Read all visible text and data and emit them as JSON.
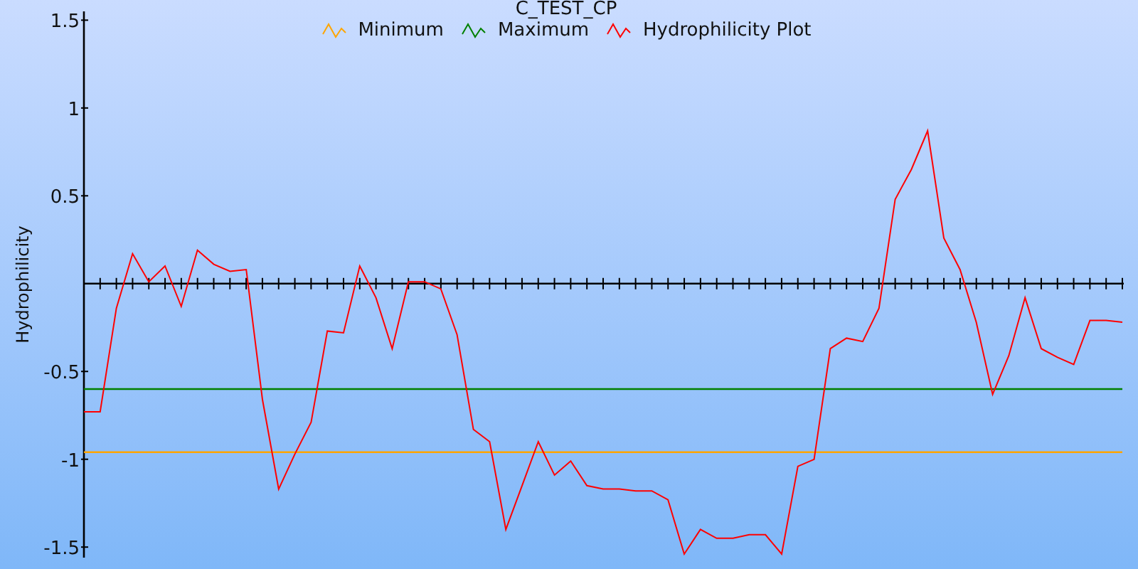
{
  "chart": {
    "chart_data": {
      "type": "line",
      "title": "C_TEST_CP",
      "ylabel": "Hydrophilicity",
      "categories": [
        null,
        null,
        null,
        null,
        null,
        null,
        null,
        null,
        null,
        null,
        null,
        null,
        null,
        null,
        null,
        null,
        null,
        null,
        null,
        null,
        null,
        null,
        null,
        null,
        null,
        null,
        null,
        null,
        null,
        null,
        null,
        null,
        null,
        null,
        null,
        null,
        null,
        null,
        null,
        null,
        null,
        null,
        null,
        null,
        null,
        null,
        null,
        null,
        null,
        null,
        null,
        null,
        null,
        null,
        null,
        null,
        null,
        null,
        null,
        null,
        null,
        null,
        null,
        null,
        null
      ],
      "ylim": [
        -1.56,
        1.55
      ],
      "yticks": [
        {
          "value": -1.5,
          "label": "-1.5"
        },
        {
          "value": -1,
          "label": "-1"
        },
        {
          "value": -0.5,
          "label": "-0.5"
        },
        {
          "value": 0.5,
          "label": "0.5"
        },
        {
          "value": 1,
          "label": "1"
        },
        {
          "value": 1.5,
          "label": "1.5"
        }
      ],
      "series": [
        {
          "name": "Minimum",
          "color": "#ffa500",
          "values": [
            -0.96,
            -0.96,
            -0.96,
            -0.96,
            -0.96,
            -0.96,
            -0.96,
            -0.96,
            -0.96,
            -0.96,
            -0.96,
            -0.96,
            -0.96,
            -0.96,
            -0.96,
            -0.96,
            -0.96,
            -0.96,
            -0.96,
            -0.96,
            -0.96,
            -0.96,
            -0.96,
            -0.96,
            -0.96,
            -0.96,
            -0.96,
            -0.96,
            -0.96,
            -0.96,
            -0.96,
            -0.96,
            -0.96,
            -0.96,
            -0.96,
            -0.96,
            -0.96,
            -0.96,
            -0.96,
            -0.96,
            -0.96,
            -0.96,
            -0.96,
            -0.96,
            -0.96,
            -0.96,
            -0.96,
            -0.96,
            -0.96,
            -0.96,
            -0.96,
            -0.96,
            -0.96,
            -0.96,
            -0.96,
            -0.96,
            -0.96,
            -0.96,
            -0.96,
            -0.96,
            -0.96,
            -0.96,
            -0.96,
            -0.96,
            -0.96
          ]
        },
        {
          "name": "Maximum",
          "color": "#008000",
          "values": [
            -0.6,
            -0.6,
            -0.6,
            -0.6,
            -0.6,
            -0.6,
            -0.6,
            -0.6,
            -0.6,
            -0.6,
            -0.6,
            -0.6,
            -0.6,
            -0.6,
            -0.6,
            -0.6,
            -0.6,
            -0.6,
            -0.6,
            -0.6,
            -0.6,
            -0.6,
            -0.6,
            -0.6,
            -0.6,
            -0.6,
            -0.6,
            -0.6,
            -0.6,
            -0.6,
            -0.6,
            -0.6,
            -0.6,
            -0.6,
            -0.6,
            -0.6,
            -0.6,
            -0.6,
            -0.6,
            -0.6,
            -0.6,
            -0.6,
            -0.6,
            -0.6,
            -0.6,
            -0.6,
            -0.6,
            -0.6,
            -0.6,
            -0.6,
            -0.6,
            -0.6,
            -0.6,
            -0.6,
            -0.6,
            -0.6,
            -0.6,
            -0.6,
            -0.6,
            -0.6,
            -0.6,
            -0.6,
            -0.6,
            -0.6,
            -0.6
          ]
        },
        {
          "name": "Hydrophilicity Plot",
          "color": "#ff0000",
          "values": [
            -0.73,
            -0.73,
            -0.14,
            0.17,
            0.01,
            0.1,
            -0.13,
            0.19,
            0.11,
            0.07,
            0.08,
            -0.66,
            -1.17,
            -0.97,
            -0.79,
            -0.27,
            -0.28,
            0.1,
            -0.08,
            -0.37,
            0.01,
            0.01,
            -0.03,
            -0.29,
            -0.83,
            -0.9,
            -1.4,
            -1.15,
            -0.9,
            -1.09,
            -1.01,
            -1.15,
            -1.17,
            -1.17,
            -1.18,
            -1.18,
            -1.23,
            -1.54,
            -1.4,
            -1.45,
            -1.45,
            -1.43,
            -1.43,
            -1.54,
            -1.04,
            -1.0,
            -0.37,
            -0.31,
            -0.33,
            -0.14,
            0.48,
            0.65,
            0.87,
            0.26,
            0.08,
            -0.22,
            -0.63,
            -0.41,
            -0.08,
            -0.37,
            -0.42,
            -0.46,
            -0.21,
            -0.21,
            -0.22
          ]
        }
      ]
    }
  }
}
